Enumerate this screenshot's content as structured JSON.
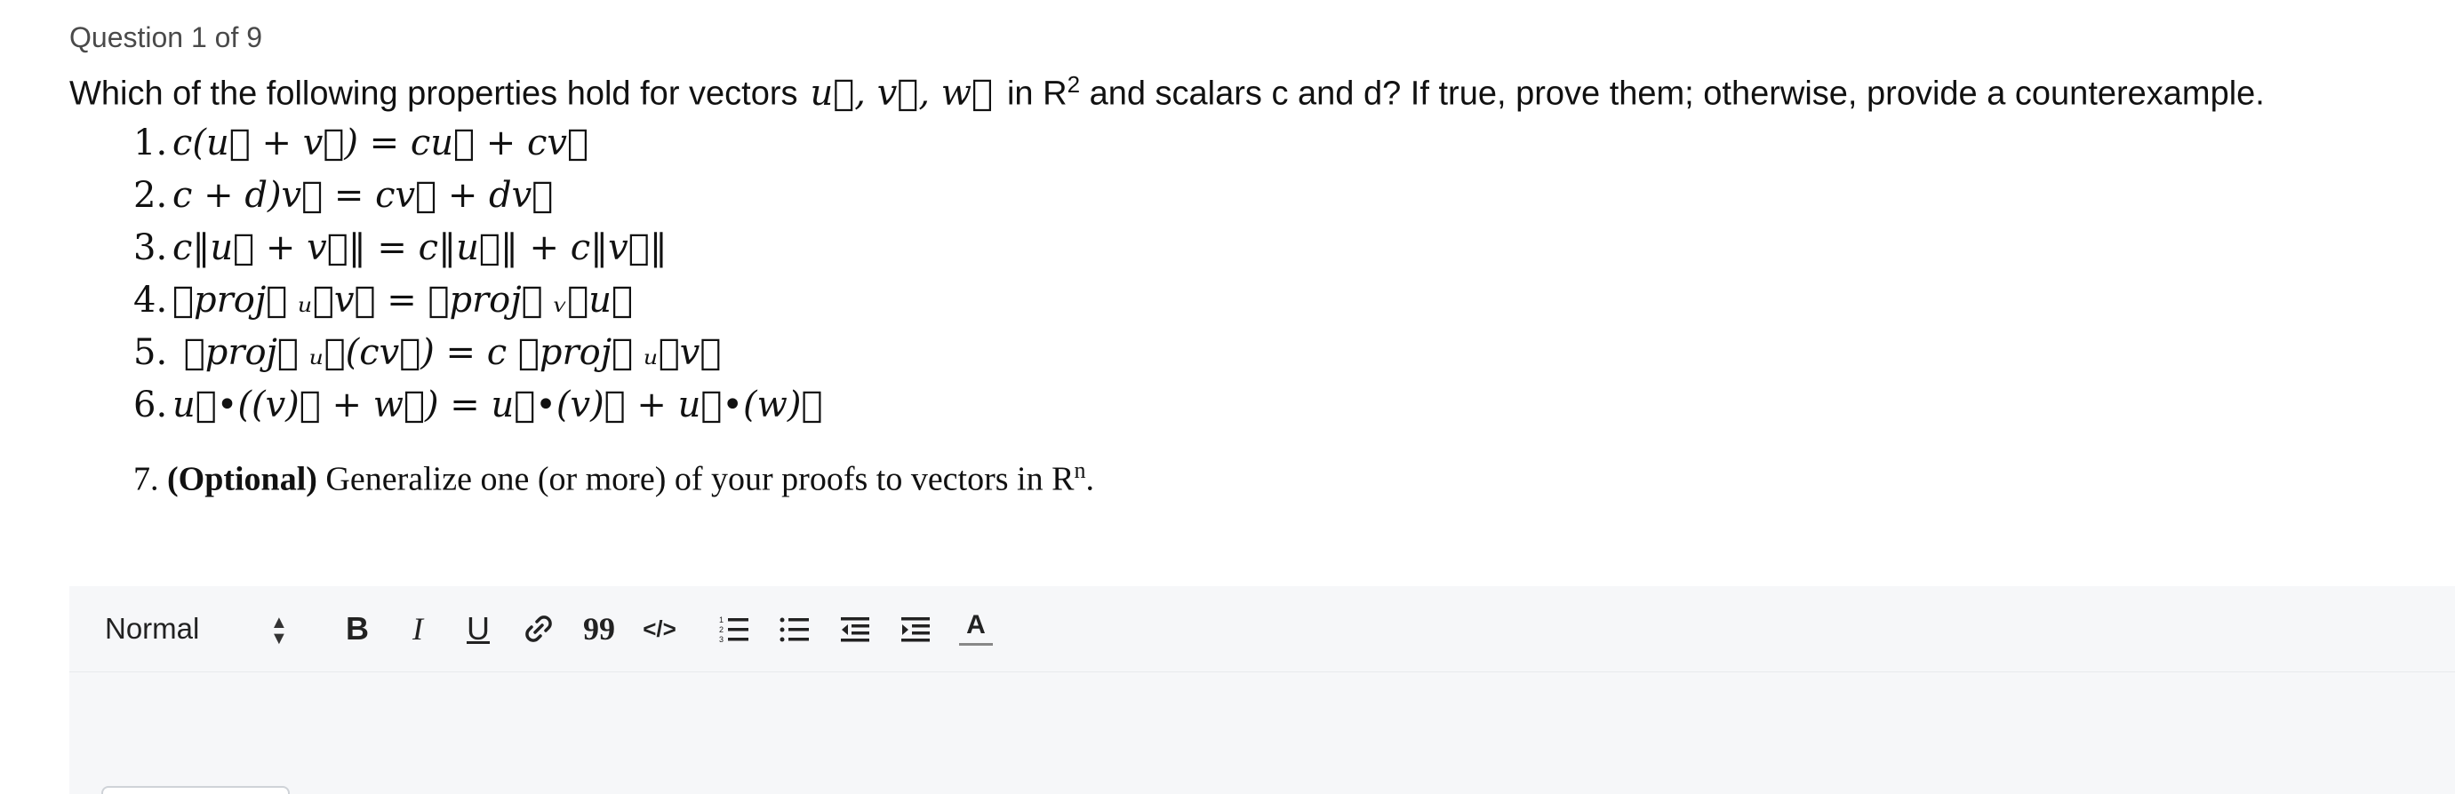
{
  "question": {
    "counter": "Question 1 of 9",
    "prompt_before": "Which of the following properties hold for vectors",
    "prompt_vectors": "u⃗, v⃗, w⃗",
    "prompt_middle": "in R",
    "prompt_sup": "2",
    "prompt_after": " and scalars c and d? If true, prove them; otherwise, provide a counterexample."
  },
  "items": [
    {
      "num": "1.",
      "math": "c(u⃗ + v⃗) = cu⃗ + cv⃗"
    },
    {
      "num": "2.",
      "math": "c + d)v⃗ = cv⃗ + dv⃗"
    },
    {
      "num": "3.",
      "math": "c‖u⃗ + v⃗‖ = c‖u⃗‖ + c‖v⃗‖"
    },
    {
      "num": "4.",
      "math": "⟦proj⟧ ᵤ⃗v⃗ =  ⟦proj⟧ ᵥ⃗u⃗"
    },
    {
      "num": "5.",
      "math": " ⟦proj⟧ ᵤ⃗(cv⃗) = c ⟦proj⟧ ᵤ⃗v⃗"
    },
    {
      "num": "6.",
      "math": "u⃗•((v)⃗ + w⃗) = u⃗•(v)⃗ + u⃗•(w)⃗"
    }
  ],
  "optional": {
    "num": "7.",
    "bold": "(Optional)",
    "text": " Generalize one (or more) of your proofs to vectors in R",
    "sup": "n",
    "end": "."
  },
  "editor": {
    "format_value": "Normal",
    "buttons": {
      "bold": "B",
      "italic": "I",
      "underline": "U",
      "quote": "99",
      "code": "</>",
      "text_color": "A"
    },
    "icons": [
      "chevron-updown-icon",
      "link-icon",
      "ordered-list-icon",
      "bullet-list-icon",
      "outdent-icon",
      "indent-icon",
      "text-color-icon"
    ]
  }
}
